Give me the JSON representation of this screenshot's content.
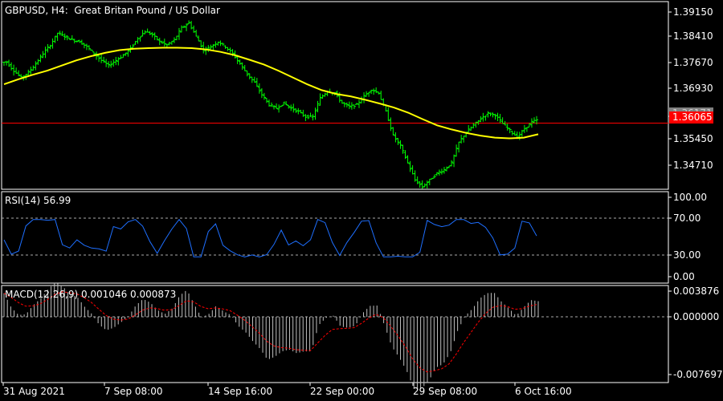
{
  "symbol_header": "GBPUSD, H4:  Great Britan Pound / US Dollar",
  "price_axis": {
    "ticks": [
      "1.39150",
      "1.38410",
      "1.37670",
      "1.36930",
      "1.36171",
      "1.35450",
      "1.34710"
    ],
    "current_price_label": "1.36065",
    "colors": {
      "bid_line": "#ff0000",
      "ask_badge": "#808080",
      "bid_badge": "#ff0000"
    }
  },
  "main_chart": {
    "bar_color": "#00ff00",
    "moving_average_color": "#ffff00"
  },
  "rsi_panel": {
    "header": "RSI(14) 56.99",
    "ticks": [
      "100.00",
      "70.00",
      "30.00",
      "0.00"
    ],
    "line_color": "#1e6fff"
  },
  "macd_panel": {
    "header": "MACD(12,26,9) 0.001046 0.000873",
    "ticks": [
      "0.003876",
      "0.000000",
      "-0.007697"
    ],
    "histogram_color": "#c0c0c0",
    "signal_color": "#ff0000"
  },
  "time_axis": {
    "ticks": [
      "31 Aug 2021",
      "7 Sep 08:00",
      "14 Sep 16:00",
      "22 Sep 00:00",
      "29 Sep 08:00",
      "6 Oct 16:00"
    ]
  },
  "chart_data": {
    "type": "line",
    "title": "GBPUSD, H4:  Great Britan Pound / US Dollar",
    "x": [
      "31 Aug 2021",
      "7 Sep 08:00",
      "14 Sep 16:00",
      "22 Sep 00:00",
      "29 Sep 08:00",
      "6 Oct 16:00"
    ],
    "ylim": [
      1.342,
      1.3955
    ],
    "last_price": 1.36065,
    "series": [
      {
        "values": [
          1.3785,
          1.376,
          1.374,
          1.3755,
          1.378,
          1.381,
          1.3835,
          1.387,
          1.386,
          1.385,
          1.3845,
          1.383,
          1.381,
          1.379,
          1.3775,
          1.379,
          1.3805,
          1.3825,
          1.3855,
          1.3875,
          1.3865,
          1.3845,
          1.3835,
          1.385,
          1.3885,
          1.39,
          1.386,
          1.382,
          1.383,
          1.3845,
          1.383,
          1.381,
          1.378,
          1.375,
          1.3725,
          1.369,
          1.366,
          1.365,
          1.3665,
          1.365,
          1.364,
          1.3625,
          1.3625,
          1.368,
          1.37,
          1.3695,
          1.3665,
          1.3655,
          1.366,
          1.3685,
          1.3705,
          1.3695,
          1.364,
          1.357,
          1.354,
          1.349,
          1.344,
          1.342,
          1.344,
          1.346,
          1.347,
          1.349,
          1.355,
          1.358,
          1.36,
          1.362,
          1.3635,
          1.363,
          1.3605,
          1.3585,
          1.3565,
          1.359,
          1.361,
          1.3617
        ]
      },
      {
        "values": [
          1.372,
          1.3735,
          1.3748,
          1.376,
          1.3775,
          1.379,
          1.3802,
          1.3812,
          1.382,
          1.3824,
          1.3826,
          1.3827,
          1.3827,
          1.3826,
          1.3822,
          1.3815,
          1.3805,
          1.3792,
          1.3778,
          1.376,
          1.374,
          1.372,
          1.3703,
          1.3692,
          1.3685,
          1.3675,
          1.3664,
          1.3652,
          1.3637,
          1.3618,
          1.36,
          1.3588,
          1.3578,
          1.357,
          1.3564,
          1.3562,
          1.3564,
          1.3574
        ]
      }
    ]
  }
}
